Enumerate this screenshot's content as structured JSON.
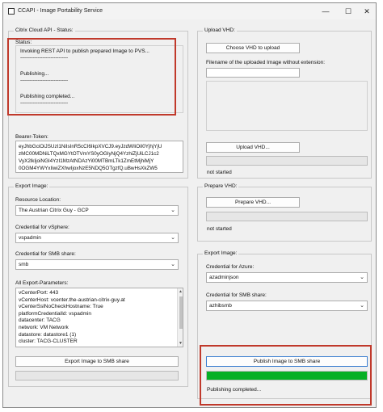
{
  "window": {
    "title": "CCAPI - Image Portability Service",
    "minimize": "—",
    "maximize": "☐",
    "close": "✕"
  },
  "status_group": {
    "title": "Citrix Cloud API - Status:",
    "status_label": "Status:",
    "lines": [
      "Invoking REST API to publish prepared Image to PVS...",
      "------------------------------",
      "Publishing...",
      "------------------------------",
      "Publishing completed...",
      "------------------------------"
    ],
    "bearer_label": "Bearer-Token:",
    "bearer_lines": [
      "eyJhbGciOiJSUzI1NiIsInR5cCI6IkpXVCJ9.eyJzdWIiOiI0YjhjYjU",
      "zMC00MDNiLTQxMGYtOTVmYS0yOGIyNjQ4YzhiZjUiLCJ1c2",
      "VyX2lkIjoiNGI4YzI1MzAtNDAzYi00MTBmLTk1ZmEtMjhiMjY",
      "0OGM4YWYxIiwiZXhwIjoxNzE5NDQ5OTgzfQ.uBwHsXkZW5"
    ]
  },
  "upload_group": {
    "title": "Upload VHD:",
    "choose_button": "Choose VHD to upload",
    "filename_label": "Filename of the uploaded Image without extension:",
    "filename_value": "",
    "upload_button": "Upload VHD...",
    "progress": 0,
    "status": "not started"
  },
  "export_image_group": {
    "title": "Export Image:",
    "resource_location_label": "Resource Location:",
    "resource_location_value": "The Austrian Citrix Guy - GCP",
    "vsphere_label": "Credential for vSphere:",
    "vsphere_value": "vspadmin",
    "smb_label": "Credential for SMB share:",
    "smb_value": "smb",
    "params_label": "All Export-Parameters:",
    "params_lines": [
      "vCenterPort: 443",
      "vCenterHost: vcenter.the-austrian-citrix-guy.at",
      "vCenterSslNoCheckHostname: True",
      "platformCredentialId: vspadmin",
      "datacenter: TACG",
      "network: VM Network",
      "datastore: datastore1 (1)",
      "cluster: TACG-CLUSTER"
    ],
    "export_button": "Export Image to SMB share",
    "progress": 0
  },
  "prepare_group": {
    "title": "Prepare VHD:",
    "prepare_button": "Prepare VHD...",
    "progress": 0,
    "status": "not started"
  },
  "export_image_right_group": {
    "title": "Export Image:",
    "azure_label": "Credential for Azure:",
    "azure_value": "azadminjson",
    "smb_label": "Credential for SMB share:",
    "smb_value": "azhibsmb",
    "publish_button": "Publish Image to SMB share",
    "progress": 100,
    "status": "Publishing completed..."
  },
  "colors": {
    "progress_fill": "#06b025",
    "highlight": "#c0392b"
  }
}
